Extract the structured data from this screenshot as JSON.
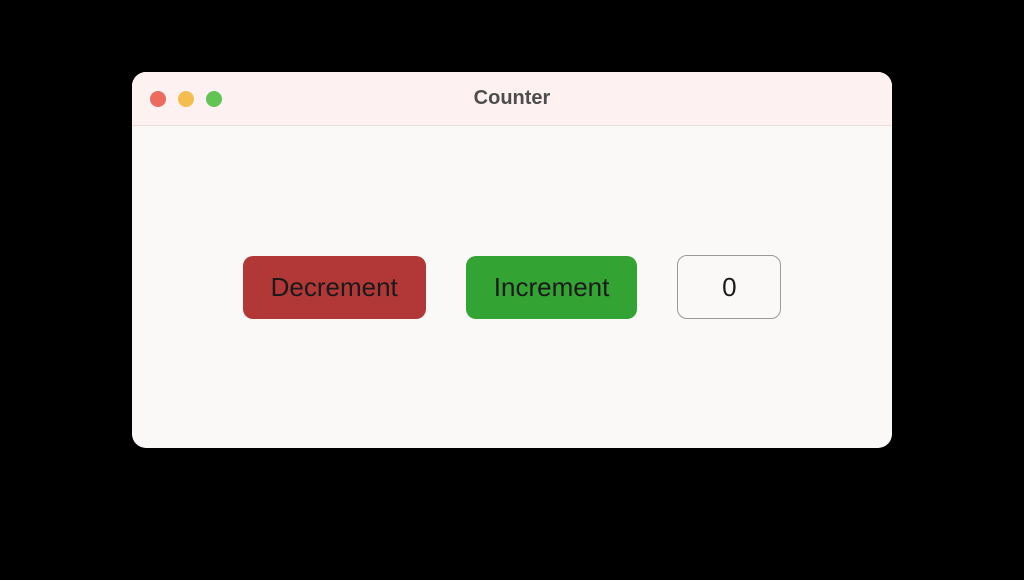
{
  "window": {
    "title": "Counter"
  },
  "controls": {
    "decrement_label": "Decrement",
    "increment_label": "Increment"
  },
  "counter": {
    "value": "0"
  },
  "colors": {
    "decrement_bg": "#b23838",
    "increment_bg": "#33a333"
  }
}
